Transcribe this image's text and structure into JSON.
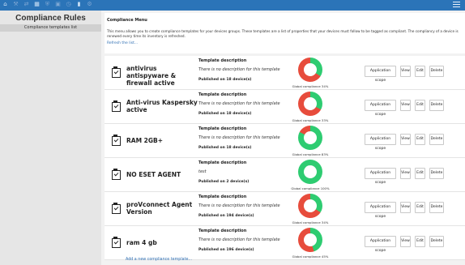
{
  "sidebar": {
    "title": "Compliance Rules",
    "item": "Compliance templates list"
  },
  "header": {
    "heading": "Compliance Menu",
    "description": "This menu allows you to create compliance templates for your devices groups. These templates are a list of properties that your devices must follow to be tagged as compliant. The compliancy of a device is renewed every time its inventory is refreshed.",
    "refresh": "Refresh the list..."
  },
  "labels": {
    "template_description": "Template description",
    "application_scope": "Application scope",
    "view": "View",
    "edit": "Edit",
    "delete": "Delete"
  },
  "colors": {
    "compliant": "#2ecc71",
    "noncompliant": "#e74c3c",
    "accent": "#2b74b8"
  },
  "templates": [
    {
      "name": "antivirus antispyware & firewall active",
      "description": "There is no description for this template",
      "published": "Published on 18 device(s)",
      "compliance_text": "Global compliance 34%",
      "compliance": 34
    },
    {
      "name": "Anti-virus Kaspersky active",
      "description": "There is no description for this template",
      "published": "Published on 18 device(s)",
      "compliance_text": "Global compliance 33%",
      "compliance": 33
    },
    {
      "name": "RAM 2GB+",
      "description": "There is no description for this template",
      "published": "Published on 18 device(s)",
      "compliance_text": "Global compliance 83%",
      "compliance": 83
    },
    {
      "name": "NO ESET AGENT",
      "description": "test",
      "published": "Published on 2 device(s)",
      "compliance_text": "Global compliance 100%",
      "compliance": 100
    },
    {
      "name": "proVconnect Agent Version",
      "description": "There is no description for this template",
      "published": "Published on 194 device(s)",
      "compliance_text": "Global compliance 34%",
      "compliance": 34
    },
    {
      "name": "ram 4 gb",
      "description": "There is no description for this template",
      "published": "Published on 196 device(s)",
      "compliance_text": "Global compliance 45%",
      "compliance": 45
    }
  ],
  "add_link": "Add a new compliance template..."
}
